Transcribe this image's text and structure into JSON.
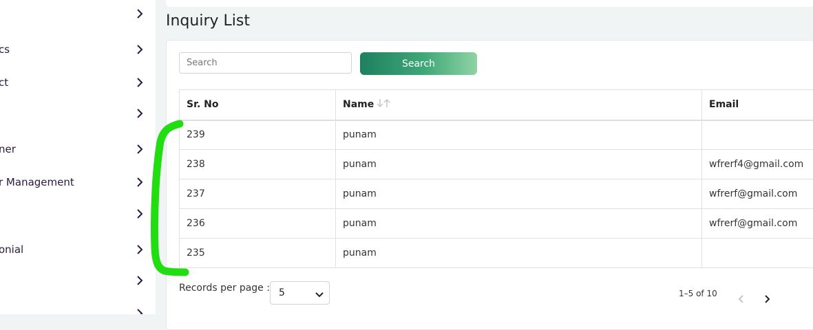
{
  "sidebar": {
    "items": [
      {
        "label": ""
      },
      {
        "label": "cs"
      },
      {
        "label": "ct"
      },
      {
        "label": ""
      },
      {
        "label": "ner"
      },
      {
        "label": "r Management"
      },
      {
        "label": ""
      },
      {
        "label": "onial"
      },
      {
        "label": ""
      },
      {
        "label": ""
      }
    ]
  },
  "page": {
    "title": "Inquiry List"
  },
  "search": {
    "placeholder": "Search",
    "value": "",
    "button_label": "Search"
  },
  "table": {
    "headers": {
      "sr": "Sr. No",
      "name": "Name",
      "email": "Email"
    },
    "rows": [
      {
        "sr": "239",
        "name": "punam",
        "email": ""
      },
      {
        "sr": "238",
        "name": "punam",
        "email": "wfrerf4@gmail.com"
      },
      {
        "sr": "237",
        "name": "punam",
        "email": "wfrerf@gmail.com"
      },
      {
        "sr": "236",
        "name": "punam",
        "email": "wfrerf@gmail.com"
      },
      {
        "sr": "235",
        "name": "punam",
        "email": ""
      }
    ]
  },
  "pagination": {
    "records_per_page_label": "Records per page :",
    "records_per_page_value": "5",
    "range_text": "1–5 of 10"
  },
  "colors": {
    "accent_start": "#1d8060",
    "accent_end": "#8fd3a4",
    "annotation": "#22dd11"
  },
  "icons": [
    "chevron-right-icon",
    "sort-icon",
    "chevron-down-icon",
    "chevron-left-icon"
  ]
}
